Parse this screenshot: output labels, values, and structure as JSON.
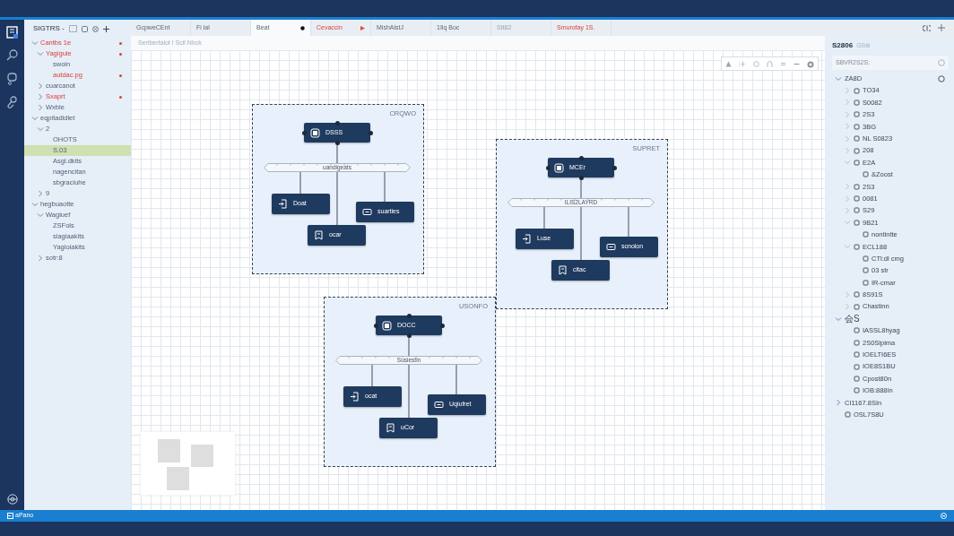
{
  "activity_bar": {
    "items": [
      {
        "selected": true
      },
      {
        "selected": false
      },
      {
        "selected": false
      },
      {
        "selected": false
      }
    ]
  },
  "sidebar": {
    "title": "SIGTRS -",
    "tree": [
      {
        "label": "Cantbs 1e",
        "expanded": true,
        "modified": true,
        "selected": false,
        "children": [
          {
            "label": "Yagiguie",
            "expanded": true,
            "modified": true,
            "selected": false,
            "children": [
              {
                "label": "swoin",
                "modified": false,
                "selected": false
              },
              {
                "label": "autdac.pg",
                "modified": true,
                "selected": false
              }
            ]
          },
          {
            "label": "cuarcanot",
            "expanded": false,
            "modified": false,
            "selected": false
          },
          {
            "label": "Sxaprt",
            "expanded": false,
            "modified": true,
            "selected": false
          },
          {
            "label": "Wxble",
            "expanded": false,
            "modified": false,
            "selected": false
          }
        ]
      },
      {
        "label": "eqpitadidlet",
        "expanded": true,
        "modified": false,
        "selected": false,
        "children": [
          {
            "label": "2",
            "expanded": true,
            "modified": false,
            "selected": false,
            "children": [
              {
                "label": "OHOTS",
                "modified": false,
                "selected": false
              },
              {
                "label": "S.03",
                "modified": false,
                "selected": true
              },
              {
                "label": "Asgl.dkits",
                "modified": false,
                "selected": false
              },
              {
                "label": "nagencitan",
                "modified": false,
                "selected": false
              },
              {
                "label": "sbgraciuhe",
                "modified": false,
                "selected": false
              }
            ]
          },
          {
            "label": "9",
            "expanded": false,
            "modified": false,
            "selected": false
          }
        ]
      },
      {
        "label": "hegbuaotte",
        "expanded": true,
        "modified": false,
        "selected": false,
        "children": [
          {
            "label": "Wagiuef",
            "expanded": true,
            "modified": false,
            "selected": false,
            "children": [
              {
                "label": "ZSFols",
                "modified": false,
                "selected": false
              },
              {
                "label": "siagiaakits",
                "modified": false,
                "selected": false
              },
              {
                "label": "Yagioiakits",
                "modified": false,
                "selected": false
              }
            ]
          },
          {
            "label": "sotr:8",
            "expanded": false,
            "modified": false,
            "selected": false
          }
        ]
      }
    ]
  },
  "tabs": [
    {
      "label": "GcpweCEnt",
      "selected": false,
      "modified": false,
      "disabled": false,
      "unsaved": false,
      "running": false
    },
    {
      "label": "Fi lal",
      "selected": false,
      "modified": false,
      "disabled": false,
      "unsaved": false,
      "running": false
    },
    {
      "label": "Beat",
      "selected": true,
      "modified": false,
      "disabled": false,
      "unsaved": true,
      "running": false
    },
    {
      "label": "Cevaccin",
      "selected": false,
      "modified": true,
      "disabled": false,
      "unsaved": false,
      "running": true
    },
    {
      "label": "MishAlstJ",
      "selected": false,
      "modified": false,
      "disabled": false,
      "unsaved": false,
      "running": false
    },
    {
      "label": "1Ilq Boc",
      "selected": false,
      "modified": false,
      "disabled": false,
      "unsaved": false,
      "running": false
    },
    {
      "label": "Stt82",
      "selected": false,
      "modified": false,
      "disabled": true,
      "unsaved": false,
      "running": false
    },
    {
      "label": "Smurofay 1S.",
      "selected": false,
      "modified": true,
      "disabled": false,
      "unsaved": false,
      "running": false
    }
  ],
  "breadcrumb": "Seribertalot I Scil Nlrck",
  "diagram": {
    "groups": [
      {
        "label": "CRQWO",
        "top": "DSSS",
        "bus": "uandigeats",
        "left": "Doat",
        "right": "suarties",
        "bottom": "ocar"
      },
      {
        "label": "SUPRET",
        "top": "MCEr",
        "bus": "ILIS2LAYRD",
        "left": "Luse",
        "right": "scnolon",
        "bottom": "citac"
      },
      {
        "label": "USONFO",
        "top": "DOCC",
        "bus": "Susiestin",
        "left": "ocat",
        "right": "Uqiufret",
        "bottom": "uCor"
      }
    ]
  },
  "outline": {
    "title": "S2806",
    "badge": "GS⊕",
    "search": {
      "placeholder": "SBVR2S2S:"
    },
    "tree": [
      {
        "label": "ZA8D",
        "expanded": true,
        "children": [
          {
            "label": "TO34",
            "expanded": false
          },
          {
            "label": "S0082",
            "expanded": false
          },
          {
            "label": "2S3",
            "expanded": false
          },
          {
            "label": "3BG",
            "expanded": false
          },
          {
            "label": "NL S0823",
            "expanded": false
          },
          {
            "label": "208",
            "expanded": false
          },
          {
            "label": "E2A",
            "expanded": true,
            "children": [
              {
                "label": "&Zoost"
              }
            ]
          },
          {
            "label": "2S3",
            "expanded": false
          },
          {
            "label": "0081",
            "expanded": false
          },
          {
            "label": "S29",
            "expanded": false
          },
          {
            "label": "9B21",
            "expanded": true,
            "children": [
              {
                "label": "nontintte"
              }
            ]
          },
          {
            "label": "ECL188",
            "expanded": true,
            "children": [
              {
                "label": "CTl:dl cmg"
              },
              {
                "label": "03 str"
              },
              {
                "label": "IR-cmar"
              }
            ]
          },
          {
            "label": "8S91S",
            "expanded": false
          },
          {
            "label": "Chastinn",
            "expanded": false
          }
        ]
      },
      {
        "label": "会S",
        "expanded": true,
        "children": [
          {
            "label": "IASSL8hyag"
          },
          {
            "label": "2S0Slpima"
          },
          {
            "label": "IOELTI6ES"
          },
          {
            "label": "IOE8S1BU"
          },
          {
            "label": "Cpost80n"
          },
          {
            "label": "IOB:888In"
          }
        ]
      },
      {
        "label": "CI1167.8SIn",
        "expanded": false
      },
      {
        "label": "OSL7S8U"
      }
    ]
  },
  "status_bar": {
    "text": "aPano"
  }
}
